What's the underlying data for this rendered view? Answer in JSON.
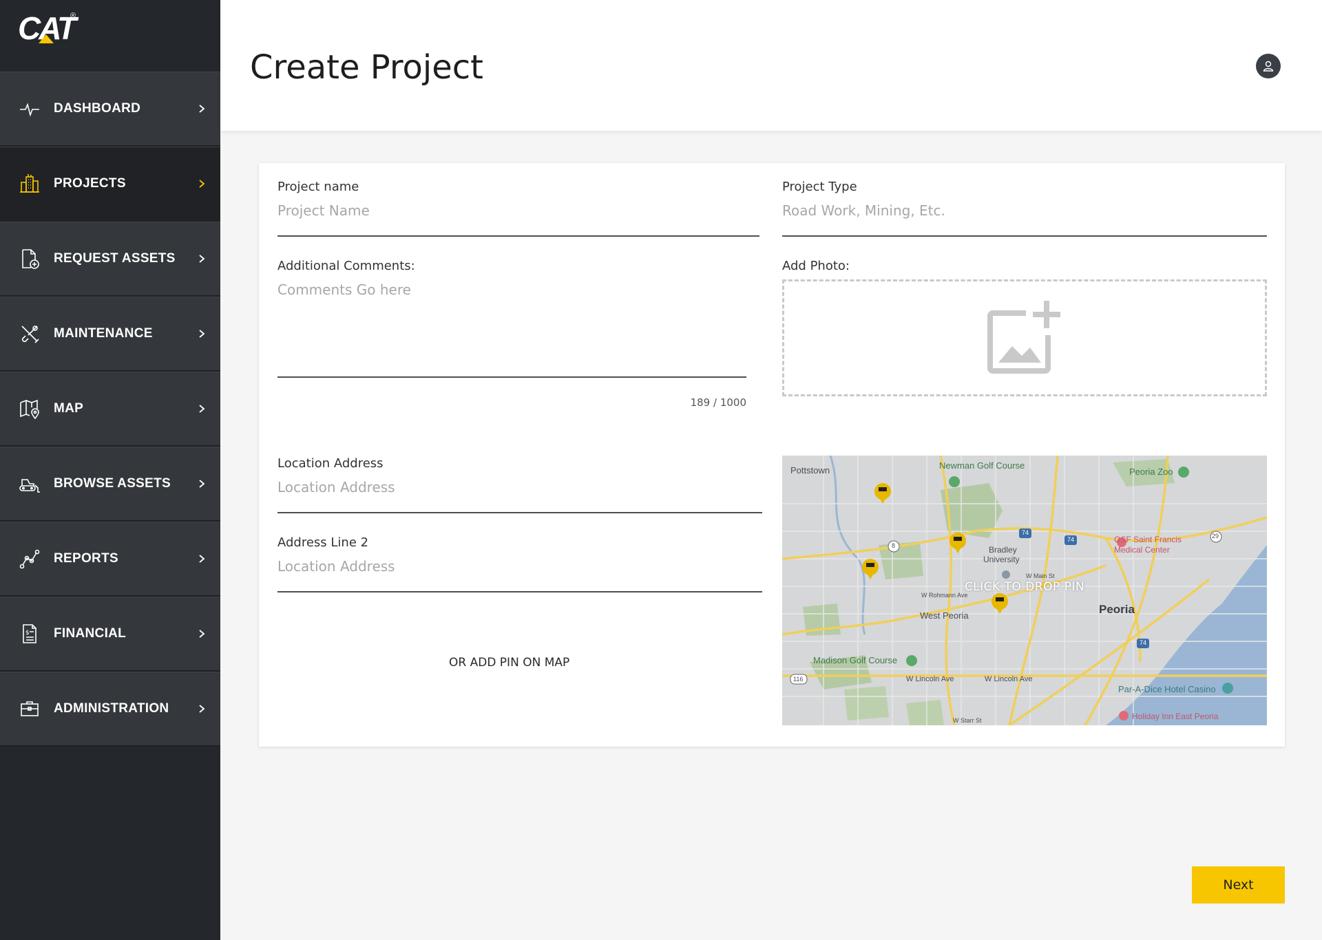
{
  "brand": {
    "logo": "CAT",
    "registered": "®",
    "accent": "#f7c600"
  },
  "sidebar": {
    "items": [
      {
        "label": "DASHBOARD",
        "icon": "pulse-icon",
        "active": false
      },
      {
        "label": "PROJECTS",
        "icon": "buildings-icon",
        "active": true
      },
      {
        "label": "REQUEST ASSETS",
        "icon": "document-add-icon",
        "active": false
      },
      {
        "label": "MAINTENANCE",
        "icon": "tools-icon",
        "active": false
      },
      {
        "label": "MAP",
        "icon": "map-pin-icon",
        "active": false
      },
      {
        "label": "BROWSE ASSETS",
        "icon": "bulldozer-icon",
        "active": false
      },
      {
        "label": "REPORTS",
        "icon": "line-chart-icon",
        "active": false
      },
      {
        "label": "FINANCIAL",
        "icon": "invoice-icon",
        "active": false
      },
      {
        "label": "ADMINISTRATION",
        "icon": "briefcase-icon",
        "active": false
      }
    ]
  },
  "header": {
    "title": "Create Project"
  },
  "form": {
    "project_name": {
      "label": "Project name",
      "placeholder": "Project Name"
    },
    "project_type": {
      "label": "Project Type",
      "placeholder": "Road Work, Mining, Etc."
    },
    "comments": {
      "label": "Additional Comments:",
      "placeholder": "Comments Go here",
      "counter": "189 / 1000"
    },
    "photo": {
      "label": "Add Photo:"
    },
    "location": {
      "label": "Location Address",
      "placeholder": "Location Address"
    },
    "address2": {
      "label": "Address Line 2",
      "placeholder": "Location Address"
    },
    "pin_link": "OR ADD PIN ON MAP"
  },
  "map": {
    "cta": "CLICK TO DROP PIN",
    "labels": {
      "pottstown": "Pottstown",
      "newman": "Newman Golf Course",
      "zoo": "Peoria Zoo",
      "osf1": "OSF Saint Francis",
      "osf2": "Medical Center",
      "bradley1": "Bradley",
      "bradley2": "University",
      "westpeoria": "West Peoria",
      "peoria": "Peoria",
      "madison": "Madison Golf Course",
      "lincoln1": "W Lincoln Ave",
      "lincoln2": "W Lincoln Ave",
      "paradice": "Par-A-Dice Hotel Casino",
      "holiday": "Holiday Inn East Peoria",
      "rohmann": "W Rohmann Ave",
      "wmain": "W Main St",
      "starr": "W Starr St",
      "i74a": "74",
      "i74b": "74",
      "i74c": "74",
      "r8": "8",
      "r29": "29",
      "r116": "116"
    }
  },
  "actions": {
    "next": "Next"
  }
}
